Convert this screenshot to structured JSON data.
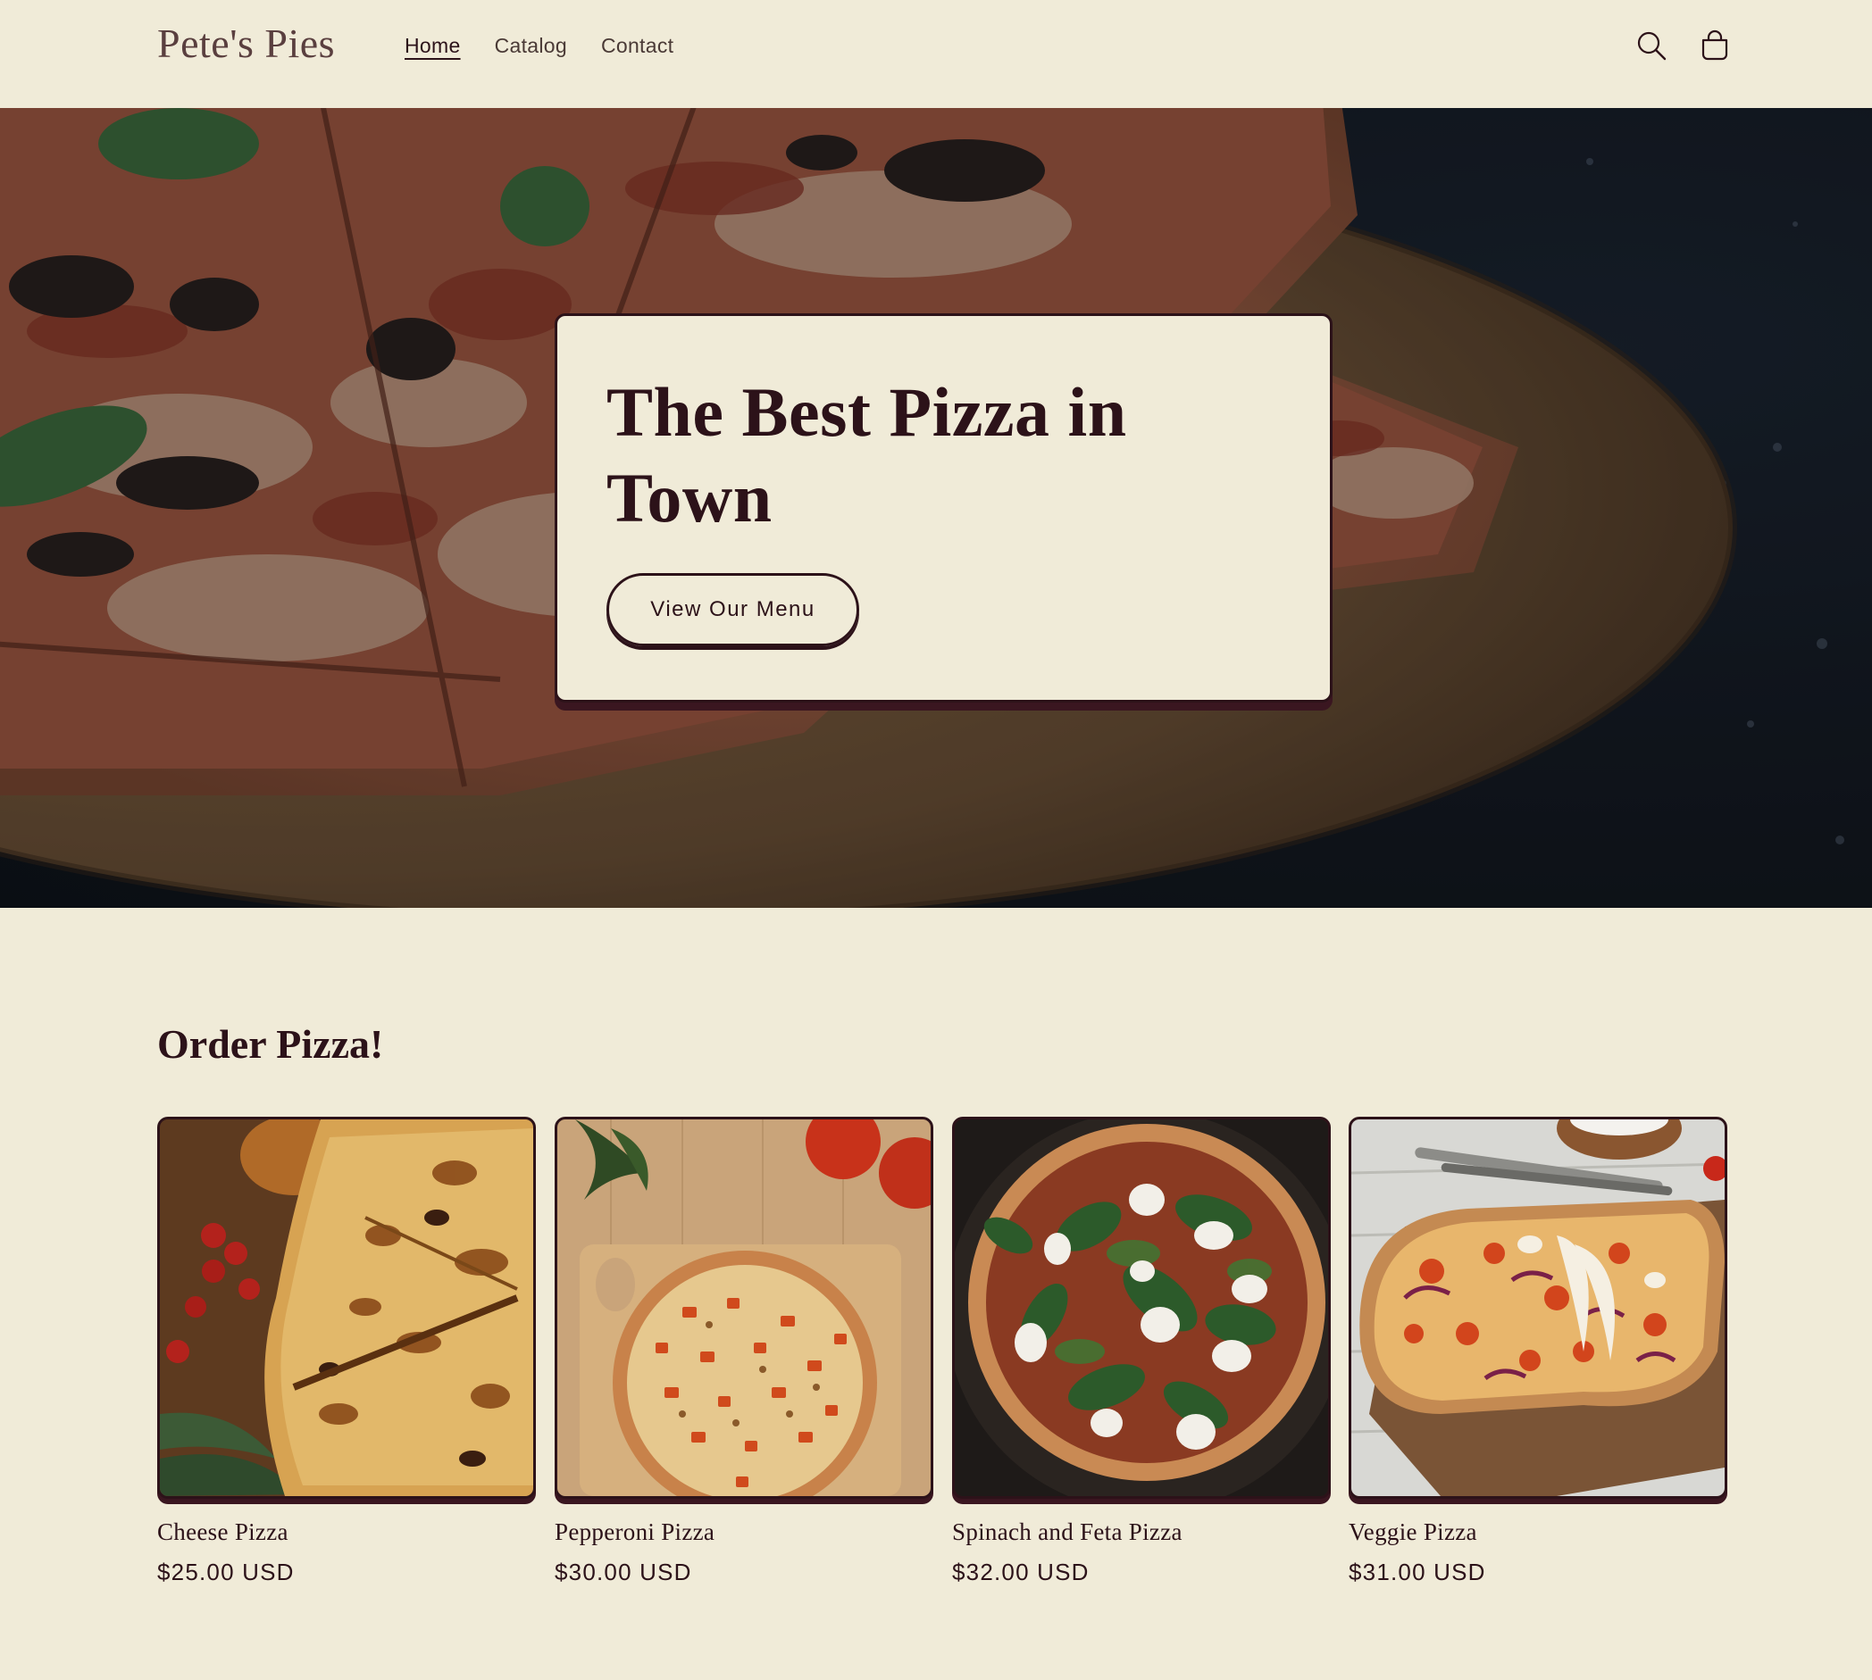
{
  "header": {
    "logo": "Pete's Pies",
    "nav": [
      {
        "label": "Home",
        "active": true
      },
      {
        "label": "Catalog",
        "active": false
      },
      {
        "label": "Contact",
        "active": false
      }
    ],
    "icons": [
      "search-icon",
      "cart-icon"
    ]
  },
  "hero": {
    "title": "The Best Pizza in Town",
    "button_label": "View Our Menu"
  },
  "products": {
    "title": "Order Pizza!",
    "items": [
      {
        "name": "Cheese Pizza",
        "price": "$25.00 USD"
      },
      {
        "name": "Pepperoni Pizza",
        "price": "$30.00 USD"
      },
      {
        "name": "Spinach and Feta Pizza",
        "price": "$32.00 USD"
      },
      {
        "name": "Veggie Pizza",
        "price": "$31.00 USD"
      }
    ]
  },
  "colors": {
    "background": "#f0ebd8",
    "text": "#2c1219",
    "accent": "#3a1620"
  }
}
